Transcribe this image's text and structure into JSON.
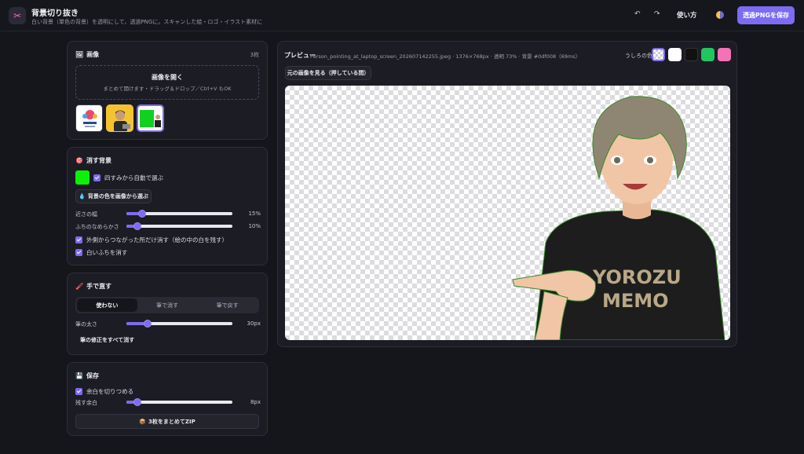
{
  "header": {
    "title": "背景切り抜き",
    "subtitle": "白い背景（単色の背景）を透明にして、透過PNGに。スキャンした絵・ロゴ・イラスト素材に",
    "undo_icon": "undo-icon",
    "redo_icon": "redo-icon",
    "help_label": "使い方",
    "save_label": "透過PNGを保存",
    "accent_color": "#7d6bf2"
  },
  "images_panel": {
    "title": "画像",
    "count": "3枚",
    "open_title": "画像を開く",
    "open_sub": "まとめて開けます・ドラッグ＆ドロップ／Ctrl+V もOK",
    "thumbnails": [
      "thumb-logo",
      "thumb-person",
      "thumb-greenscreen"
    ]
  },
  "remove_panel": {
    "title": "消す背景",
    "color": "#0df008",
    "auto_pick_label": "四すみから自動で選ぶ",
    "eyedropper_label": "背景の色を画像から選ぶ",
    "tolerance_label": "近さの幅",
    "tolerance_value": "15%",
    "tolerance_fraction": 0.15,
    "smooth_label": "ふちのなめらかさ",
    "smooth_value": "10%",
    "smooth_fraction": 0.1,
    "outside_only_label": "外側からつながった所だけ消す（絵の中の白を残す）",
    "white_edge_label": "白いふちを消す"
  },
  "manual_panel": {
    "title": "手で直す",
    "modes": [
      "使わない",
      "筆で消す",
      "筆で戻す"
    ],
    "active_mode": 0,
    "brush_label": "筆の太さ",
    "brush_value": "30px",
    "brush_fraction": 0.2,
    "reset_label": "筆の修正をすべて消す"
  },
  "save_panel": {
    "title": "保存",
    "trim_label": "余白を切りつめる",
    "margin_label": "残す余白",
    "margin_value": "8px",
    "margin_fraction": 0.1,
    "zip_label": "3枚をまとめてZIP"
  },
  "preview": {
    "title": "プレビュー",
    "meta": "Person_pointing_at_laptop_screen_202607142255.jpeg · 1376×768px · 透明 73% · 背景 #0df008（69ms）",
    "bg_label": "うしろの色",
    "swatches": [
      "checker",
      "#ffffff",
      "#111111",
      "#22c55e",
      "#f472b6"
    ],
    "compare_label": "元の画像を見る（押している間）",
    "shirt_line1": "YOROZU",
    "shirt_line2": "MEMO"
  }
}
